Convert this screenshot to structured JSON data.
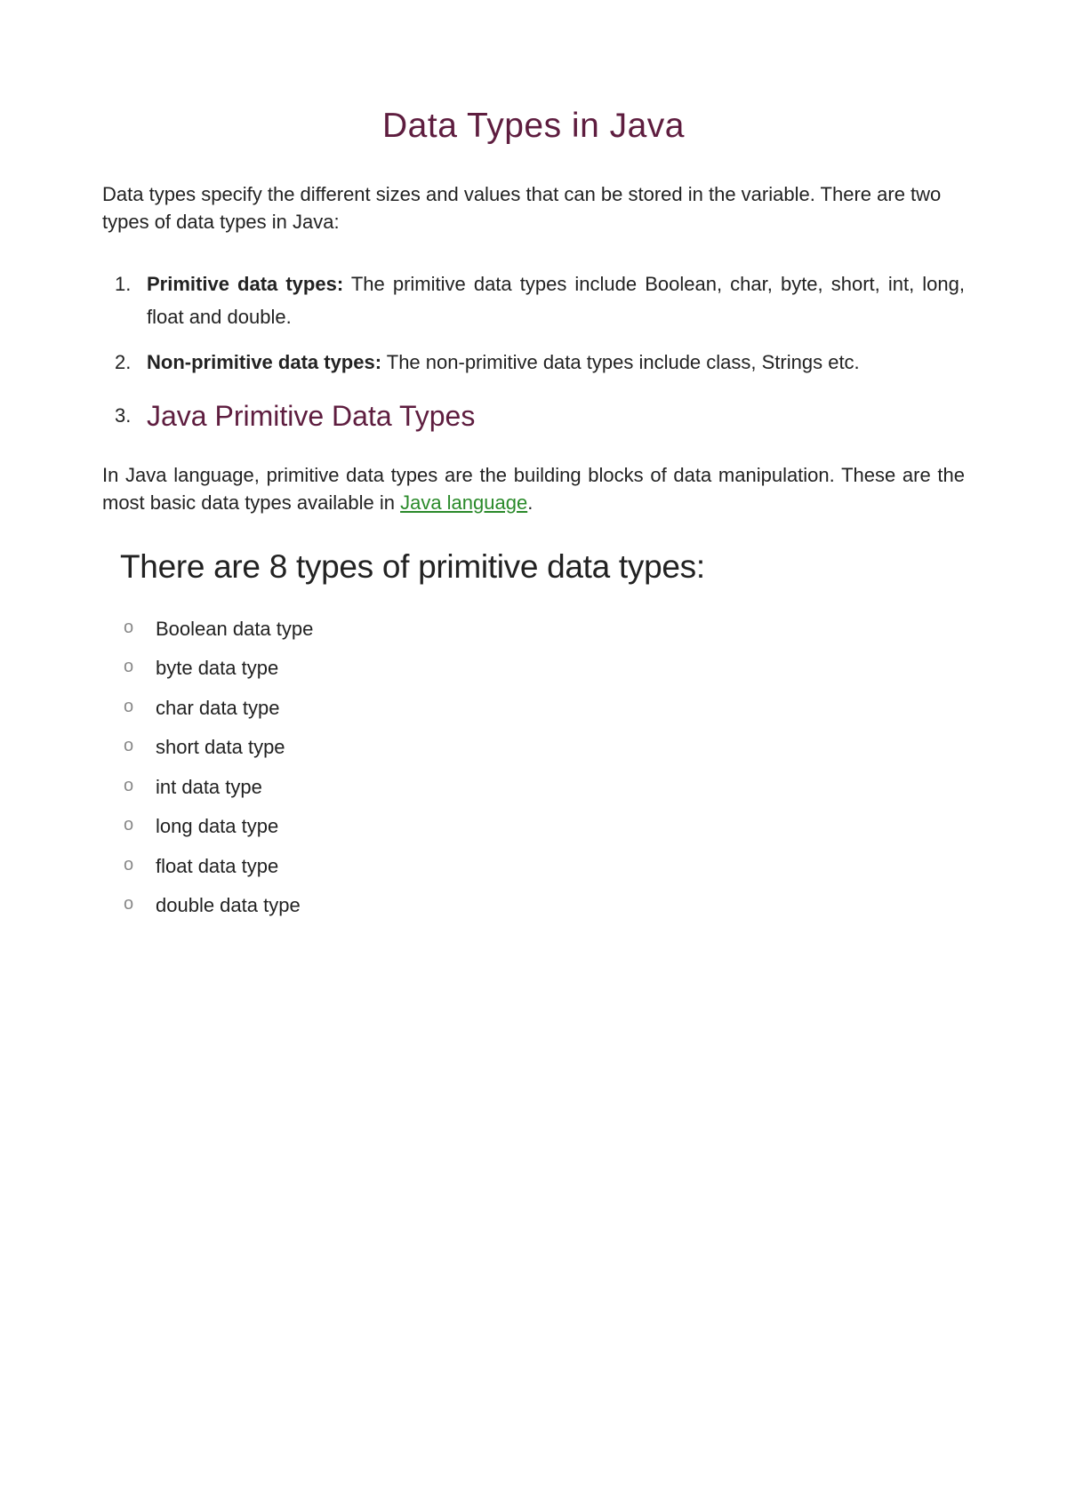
{
  "title": "Data Types in Java",
  "intro": "Data types specify the different sizes and values that can be stored in the variable. There are two types of data types in Java:",
  "numbered_items": {
    "item1": {
      "num": "1.",
      "bold": "Primitive data types:",
      "rest": " The primitive data types include Boolean, char, byte, short, int, long, float and double."
    },
    "item2": {
      "num": "2.",
      "bold": "Non-primitive data types:",
      "rest": " The non-primitive data types include class, Strings etc."
    },
    "item3": {
      "num": "3.",
      "heading": "Java Primitive Data Types"
    }
  },
  "paragraph": {
    "before_link": "In Java language, primitive data types are the building blocks of data manipulation. These are the most basic data types available in ",
    "link_text": "Java language",
    "after_link": "."
  },
  "section_header": "There are 8 types of primitive data types:",
  "primitive_types": {
    "t0": "Boolean data type",
    "t1": "byte data type",
    "t2": "char data type",
    "t3": "short data type",
    "t4": "int data type",
    "t5": "long data type",
    "t6": "float data type",
    "t7": "double data type"
  }
}
